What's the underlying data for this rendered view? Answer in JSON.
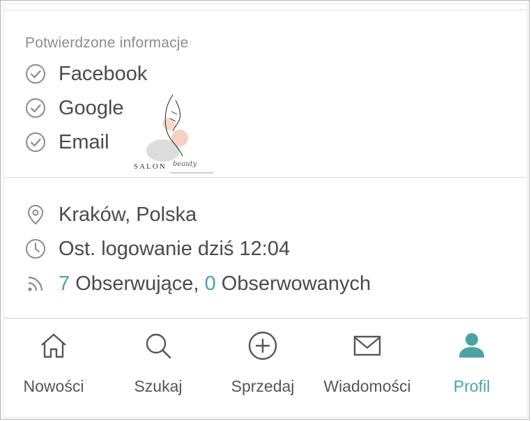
{
  "verified": {
    "title": "Potwierdzone informacje",
    "items": [
      {
        "label": "Facebook",
        "icon": "check-circle-icon"
      },
      {
        "label": "Google",
        "icon": "check-circle-icon"
      },
      {
        "label": "Email",
        "icon": "check-circle-icon"
      }
    ]
  },
  "logo": {
    "text": "SALON",
    "script": "beauty"
  },
  "details": {
    "location": "Kraków, Polska",
    "last_login": "Ost. logowanie dziś 12:04",
    "followers_count": "7",
    "followers_label": " Obserwujące, ",
    "following_count": "0",
    "following_label": " Obserwowanych"
  },
  "nav": {
    "items": [
      {
        "label": "Nowości",
        "icon": "home-icon"
      },
      {
        "label": "Szukaj",
        "icon": "search-icon"
      },
      {
        "label": "Sprzedaj",
        "icon": "plus-circle-icon"
      },
      {
        "label": "Wiadomości",
        "icon": "mail-icon"
      },
      {
        "label": "Profil",
        "icon": "user-icon",
        "active": true
      }
    ]
  },
  "colors": {
    "accent": "#4aa3a3",
    "text": "#4a4a4a",
    "muted": "#8c8c8c"
  }
}
